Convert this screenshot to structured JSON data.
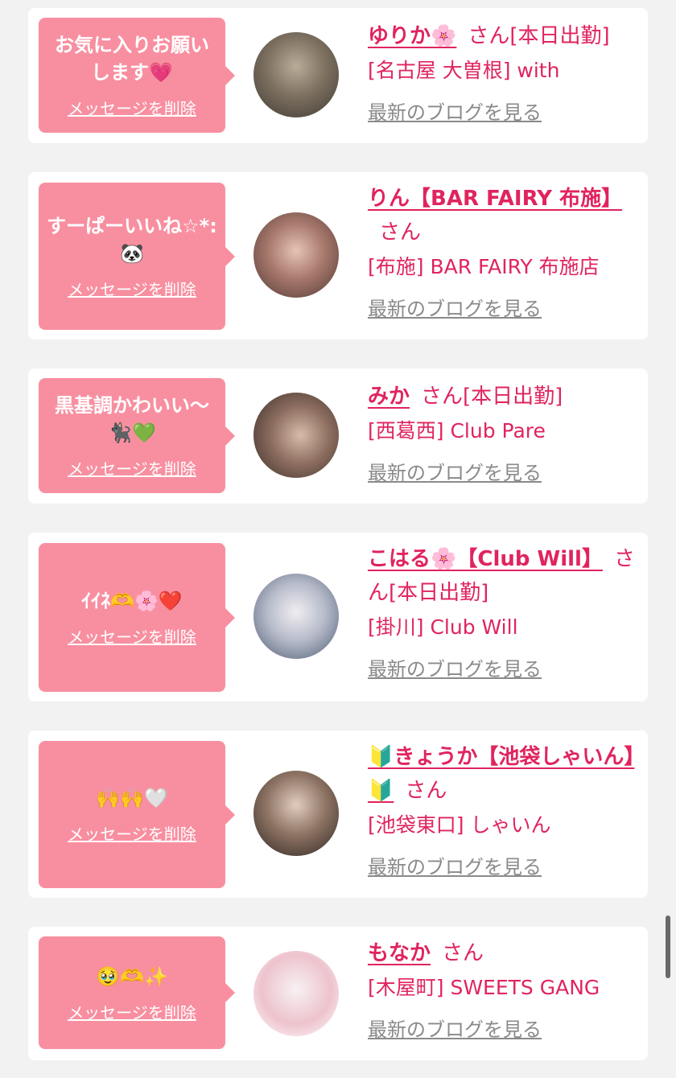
{
  "delete_label": "メッセージを削除",
  "blog_label": "最新のブログを見る",
  "san_label": "さん",
  "cards": [
    {
      "message": "お気に入りお願い\nします💗",
      "name": "ゆりか🌸",
      "status": "[本日出勤]",
      "shop": "[名古屋 大曽根] with"
    },
    {
      "message": "すーぱーいいね☆*:\n🐼",
      "name": "りん【BAR FAIRY 布施】",
      "status": "",
      "shop": "[布施] BAR FAIRY 布施店"
    },
    {
      "message": "黒基調かわいい〜\n🐈‍⬛💚",
      "name": "みか",
      "status": "[本日出勤]",
      "shop": "[西葛西] Club Pare"
    },
    {
      "message": "ｲｲﾈ🫶🌸❤️",
      "name": "こはる🌸【Club Will】",
      "status": "[本日出勤]",
      "shop": "[掛川] Club Will"
    },
    {
      "message": "🙌🙌🤍",
      "name": "🔰きょうか【池袋しゃいん】🔰",
      "status": "",
      "shop": "[池袋東口] しゃいん"
    },
    {
      "message": "🥹🫶✨",
      "name": "もなか",
      "status": "",
      "shop": "[木屋町] SWEETS GANG"
    }
  ],
  "avatar_colors": [
    [
      "#5a5044",
      "#b9ac98"
    ],
    [
      "#6a4a45",
      "#d9b6a8"
    ],
    [
      "#4a3a32",
      "#c7a896"
    ],
    [
      "#7f8ea3",
      "#e9e4ea"
    ],
    [
      "#3a2c26",
      "#c9b2a2"
    ],
    [
      "#f3e7ea",
      "#e6a7b5"
    ]
  ]
}
